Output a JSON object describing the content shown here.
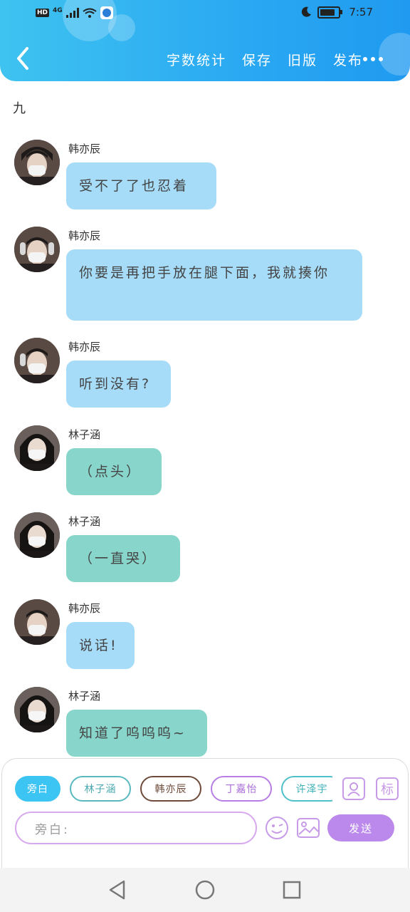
{
  "status_bar": {
    "left_badges": [
      "HD",
      "4G"
    ],
    "time": "7:57"
  },
  "header": {
    "menu": [
      "字数统计",
      "保存",
      "旧版",
      "发布"
    ],
    "icons": {
      "back": "back-arrow-icon",
      "more": "more-dots-icon"
    }
  },
  "chapter": {
    "title": "九"
  },
  "colors": {
    "header_gradient": [
      "#3ec3f0",
      "#1f9af0"
    ],
    "bubble_blue": "#a6dcf8",
    "bubble_teal": "#88d6cb",
    "send_button": "#bb88ec",
    "chip_active": "#3cc4f2"
  },
  "messages": [
    {
      "sender": "韩亦辰",
      "text": "受不了了也忍着",
      "style": "blue"
    },
    {
      "sender": "韩亦辰",
      "text": "你要是再把手放在腿下面，我就揍你",
      "style": "blue"
    },
    {
      "sender": "韩亦辰",
      "text": "听到没有?",
      "style": "blue"
    },
    {
      "sender": "林子涵",
      "text": "（点头）",
      "style": "teal"
    },
    {
      "sender": "林子涵",
      "text": "（一直哭）",
      "style": "teal"
    },
    {
      "sender": "韩亦辰",
      "text": "说话!",
      "style": "blue"
    },
    {
      "sender": "林子涵",
      "text": "知道了呜呜呜~",
      "style": "teal"
    }
  ],
  "composer": {
    "roles": [
      "旁白",
      "林子涵",
      "韩亦辰",
      "丁嘉怡",
      "许泽宇"
    ],
    "active_role": "旁白",
    "input_value": "旁白:",
    "send_label": "发送",
    "label_button": "标",
    "icons": [
      "role-manage-icon",
      "emoji-icon",
      "image-icon"
    ]
  },
  "nav_bar": {
    "icons": [
      "nav-back-icon",
      "nav-home-icon",
      "nav-recents-icon"
    ]
  }
}
